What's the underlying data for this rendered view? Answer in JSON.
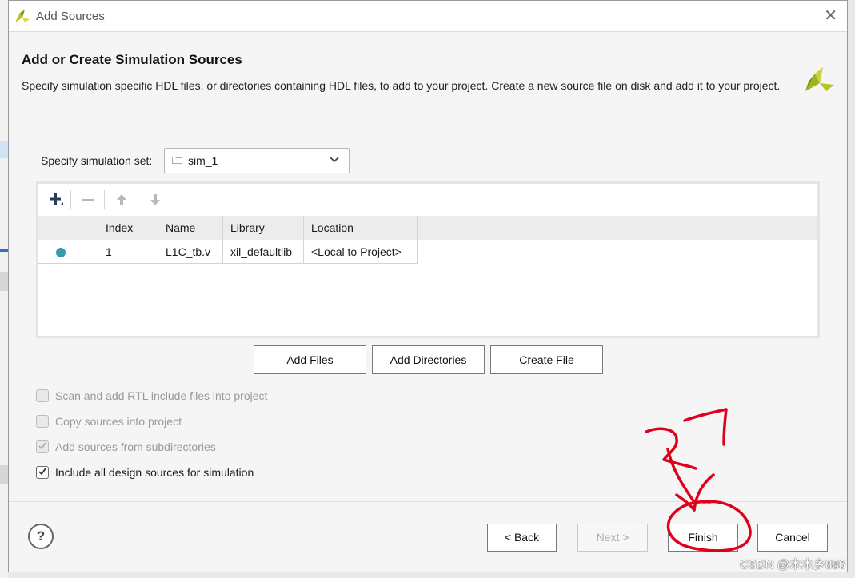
{
  "window": {
    "title": "Add Sources",
    "close_glyph": "✕"
  },
  "header": {
    "title": "Add or Create Simulation Sources",
    "description": "Specify simulation specific HDL files, or directories containing HDL files, to add to your project. Create a new source file on disk and add it to your project."
  },
  "simulation_set": {
    "label": "Specify simulation set:",
    "value": "sim_1"
  },
  "toolbar": {
    "icons": [
      "add-icon",
      "remove-icon",
      "move-up-icon",
      "move-down-icon"
    ]
  },
  "table": {
    "columns": [
      "",
      "Index",
      "Name",
      "Library",
      "Location"
    ],
    "rows": [
      {
        "status": "dot",
        "index": "1",
        "name": "L1C_tb.v",
        "library": "xil_defaultlib",
        "location": "<Local to Project>"
      }
    ]
  },
  "actions": {
    "add_files": "Add Files",
    "add_directories": "Add Directories",
    "create_file": "Create File"
  },
  "options": [
    {
      "label": "Scan and add RTL include files into project",
      "checked": false,
      "enabled": false
    },
    {
      "label": "Copy sources into project",
      "checked": false,
      "enabled": false
    },
    {
      "label": "Add sources from subdirectories",
      "checked": true,
      "enabled": false
    },
    {
      "label": "Include all design sources for simulation",
      "checked": true,
      "enabled": true
    }
  ],
  "footer": {
    "help": "?",
    "back": "< Back",
    "next": "Next >",
    "finish": "Finish",
    "cancel": "Cancel"
  },
  "watermark": "CSDN @木木乡886",
  "colors": {
    "status_dot": "#3a98ad",
    "annotation": "#e0001b",
    "brand_logo": "#b4c424"
  }
}
